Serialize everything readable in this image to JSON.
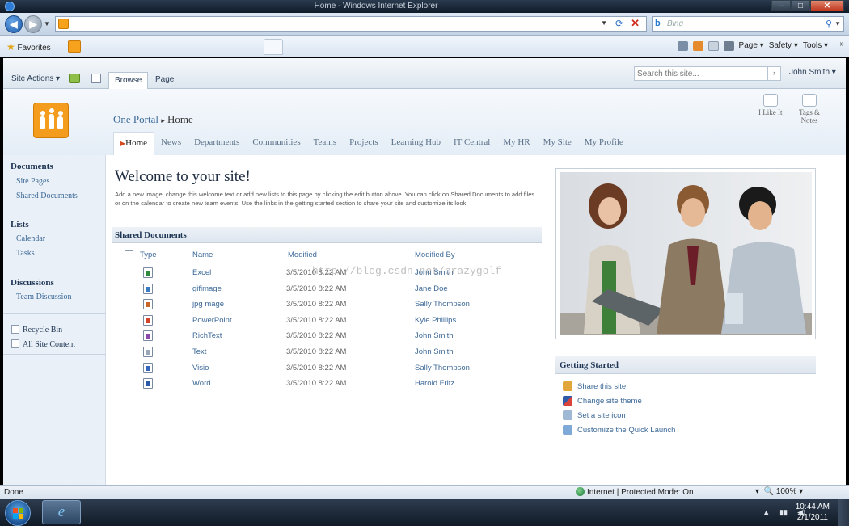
{
  "browser": {
    "window_title": "Home - Windows Internet Explorer",
    "search_engine": "Bing",
    "favorites_label": "Favorites",
    "commands": [
      "Page ▾",
      "Safety ▾",
      "Tools ▾"
    ],
    "status_left": "Done",
    "status_zone": "Internet | Protected Mode: On",
    "zoom": "100%"
  },
  "sharepoint": {
    "site_actions": "Site Actions ▾",
    "ribbon_tabs": [
      "Browse",
      "Page"
    ],
    "search_placeholder": "Search this site...",
    "user_name": "John Smith ▾",
    "breadcrumb": {
      "site": "One Portal",
      "separator": "▸",
      "current": "Home"
    },
    "social": {
      "like": "I Like It",
      "tags_line1": "Tags &",
      "tags_line2": "Notes"
    },
    "topnav": [
      "Home",
      "News",
      "Departments",
      "Communities",
      "Teams",
      "Projects",
      "Learning Hub",
      "IT Central",
      "My HR",
      "My Site",
      "My Profile"
    ],
    "quicklaunch": {
      "documents_heading": "Documents",
      "documents_links": [
        "Site Pages",
        "Shared Documents"
      ],
      "lists_heading": "Lists",
      "lists_links": [
        "Calendar",
        "Tasks"
      ],
      "discussions_heading": "Discussions",
      "discussions_links": [
        "Team Discussion"
      ],
      "recycle_bin": "Recycle Bin",
      "all_content": "All Site Content"
    },
    "welcome": {
      "title": "Welcome to your site!",
      "text": "Add a new image, change this welcome text or add new lists to this page by clicking the edit button above. You can click on Shared Documents to add files or on the calendar to create new team events. Use the links in the getting started section to share your site and customize its look."
    },
    "shared_documents": {
      "heading": "Shared Documents",
      "columns": [
        "Type",
        "Name",
        "Modified",
        "Modified By"
      ],
      "rows": [
        {
          "icon": "excel-file-icon",
          "color": "#2f8a3e",
          "name": "Excel",
          "modified": "3/5/2010 8:22 AM",
          "by": "John Smith"
        },
        {
          "icon": "image-file-icon",
          "color": "#3a7cc2",
          "name": "gifimage",
          "modified": "3/5/2010 8:22 AM",
          "by": "Jane Doe"
        },
        {
          "icon": "image-file-icon",
          "color": "#c8662a",
          "name": "jpg mage",
          "modified": "3/5/2010 8:22 AM",
          "by": "Sally Thompson"
        },
        {
          "icon": "powerpoint-file-icon",
          "color": "#d2452a",
          "name": "PowerPoint",
          "modified": "3/5/2010 8:22 AM",
          "by": "Kyle Phillips"
        },
        {
          "icon": "richtext-file-icon",
          "color": "#8c4aa8",
          "name": "RichText",
          "modified": "3/5/2010 8:22 AM",
          "by": "John Smith"
        },
        {
          "icon": "text-file-icon",
          "color": "#9aa7b6",
          "name": "Text",
          "modified": "3/5/2010 8:22 AM",
          "by": "John Smith"
        },
        {
          "icon": "visio-file-icon",
          "color": "#3565b8",
          "name": "Visio",
          "modified": "3/5/2010 8:22 AM",
          "by": "Sally Thompson"
        },
        {
          "icon": "word-file-icon",
          "color": "#2b5aa8",
          "name": "Word",
          "modified": "3/5/2010 8:22 AM",
          "by": "Harold Fritz"
        }
      ]
    },
    "watermark": "http://blog.csdn.net/crazygolf",
    "getting_started": {
      "heading": "Getting Started",
      "items": [
        "Share this site",
        "Change site theme",
        "Set a site icon",
        "Customize the Quick Launch"
      ]
    }
  },
  "taskbar": {
    "time": "10:44 AM",
    "date": "2/1/2011"
  },
  "colors": {
    "accent_orange": "#f39c1e",
    "link_blue": "#3d6a98",
    "heading_navy": "#1e3554"
  }
}
